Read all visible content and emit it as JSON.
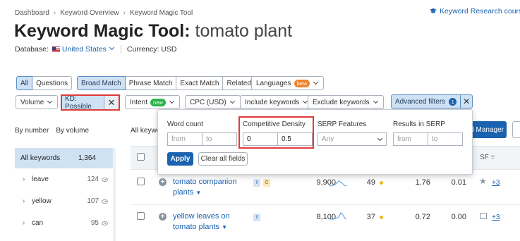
{
  "breadcrumb": [
    "Dashboard",
    "Keyword Overview",
    "Keyword Magic Tool"
  ],
  "course_link": "Keyword Research course",
  "title": {
    "tool": "Keyword Magic Tool:",
    "query": "tomato plant"
  },
  "database": {
    "label": "Database:",
    "value": "United States",
    "currency_label": "Currency: USD"
  },
  "match_tabs": [
    "All",
    "Questions"
  ],
  "match_types": [
    "Broad Match",
    "Phrase Match",
    "Exact Match",
    "Related"
  ],
  "languages": {
    "label": "Languages",
    "badge": "beta"
  },
  "filters": {
    "volume": "Volume",
    "kd": "KD: Possible",
    "intent": "Intent",
    "intent_badge": "new",
    "cpc": "CPC (USD)",
    "include": "Include keywords",
    "exclude": "Exclude keywords",
    "advanced": "Advanced filters",
    "advanced_count": "1"
  },
  "side_tabs": [
    "By number",
    "By volume"
  ],
  "side": {
    "all_label": "All keywords",
    "all_count": "1,364",
    "items": [
      {
        "name": "leave",
        "count": "124"
      },
      {
        "name": "yellow",
        "count": "107"
      },
      {
        "name": "can",
        "count": "95"
      }
    ]
  },
  "all_keywords_label": "All keywo",
  "keyword_manager_label": "d Manager",
  "sf_header": "SF",
  "rows": [
    {
      "kw1": "tomato companion",
      "kw2": "plants",
      "tags": [
        "I",
        "C"
      ],
      "volume": "9,900",
      "kd": "49",
      "cpc": "1.76",
      "com": "0.01",
      "more": "+3"
    },
    {
      "kw1": "yellow leaves on",
      "kw2": "tomato plants",
      "tags": [
        "I"
      ],
      "volume": "8,100",
      "kd": "37",
      "cpc": "0.72",
      "com": "0.00",
      "more": "+3"
    }
  ],
  "popup": {
    "word_count": "Word count",
    "comp_density": "Competitive Density",
    "serp_features": "SERP Features",
    "results_in_serp": "Results in SERP",
    "from_placeholder": "from",
    "to_placeholder": "to",
    "comp_from": "0",
    "comp_to": "0.5",
    "any_placeholder": "Any",
    "apply": "Apply",
    "clear": "Clear all fields"
  },
  "colors": {
    "accent": "#1a62b0",
    "highlight": "#e23b3b",
    "selected_bg": "#cfe2f4"
  }
}
